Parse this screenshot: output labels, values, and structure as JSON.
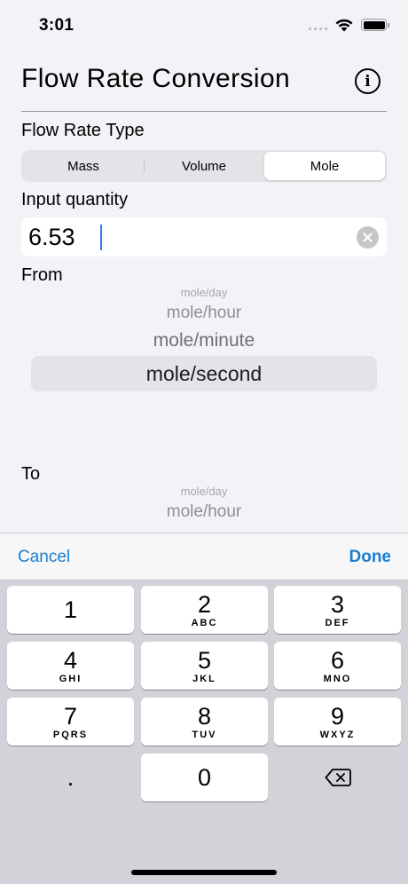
{
  "status_bar": {
    "time": "3:01"
  },
  "header": {
    "title": "Flow Rate Conversion",
    "info_icon": "info-circle-icon"
  },
  "flow_type": {
    "label": "Flow Rate Type",
    "segments": [
      "Mass",
      "Volume",
      "Mole"
    ],
    "selected": "Mole"
  },
  "input": {
    "label": "Input quantity",
    "value": "6.53"
  },
  "from": {
    "label": "From",
    "options": [
      "mole/day",
      "mole/hour",
      "mole/minute",
      "mole/second"
    ],
    "selected": "mole/second"
  },
  "to": {
    "label": "To",
    "options": [
      "mole/day",
      "mole/hour"
    ]
  },
  "toolbar": {
    "cancel": "Cancel",
    "done": "Done"
  },
  "keypad": {
    "keys": [
      {
        "digit": "1",
        "letters": ""
      },
      {
        "digit": "2",
        "letters": "ABC"
      },
      {
        "digit": "3",
        "letters": "DEF"
      },
      {
        "digit": "4",
        "letters": "GHI"
      },
      {
        "digit": "5",
        "letters": "JKL"
      },
      {
        "digit": "6",
        "letters": "MNO"
      },
      {
        "digit": "7",
        "letters": "PQRS"
      },
      {
        "digit": "8",
        "letters": "TUV"
      },
      {
        "digit": "9",
        "letters": "WXYZ"
      },
      {
        "digit": ".",
        "letters": ""
      },
      {
        "digit": "0",
        "letters": ""
      }
    ],
    "delete_icon": "backspace-icon"
  },
  "colors": {
    "accent": "#1a7ed1",
    "caret": "#3478f6",
    "background": "#f2f2f7",
    "keyboard": "#d1d3d9"
  }
}
